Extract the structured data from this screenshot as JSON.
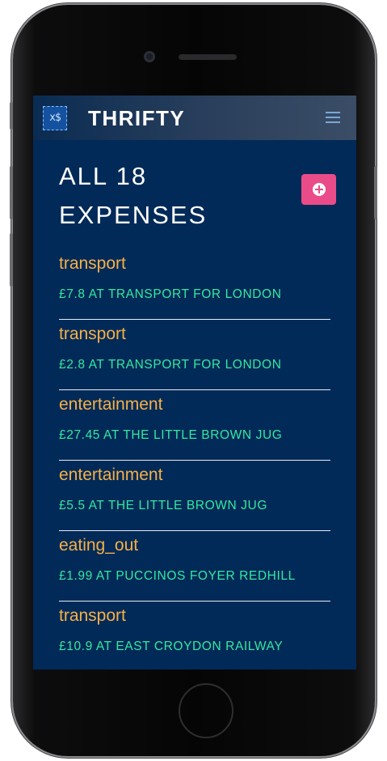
{
  "app": {
    "brand": "THRIFTY",
    "logo_glyph": "x$"
  },
  "page": {
    "title_line1": "ALL 18",
    "title_line2": "EXPENSES"
  },
  "colors": {
    "background": "#012a58",
    "category": "#f6b049",
    "detail": "#35e8a1",
    "accent_button": "#ea4c89"
  },
  "icons": {
    "menu": "hamburger-icon",
    "add": "plus-circle-icon",
    "logo": "dollar-logo-icon"
  },
  "expenses": [
    {
      "category": "transport",
      "detail": "£7.8 AT TRANSPORT FOR LONDON"
    },
    {
      "category": "transport",
      "detail": "£2.8 AT TRANSPORT FOR LONDON"
    },
    {
      "category": "entertainment",
      "detail": "£27.45 AT THE LITTLE BROWN JUG"
    },
    {
      "category": "entertainment",
      "detail": "£5.5 AT THE LITTLE BROWN JUG"
    },
    {
      "category": "eating_out",
      "detail": "£1.99 AT PUCCINOS FOYER REDHILL"
    },
    {
      "category": "transport",
      "detail": "£10.9 AT EAST CROYDON RAILWAY"
    }
  ]
}
